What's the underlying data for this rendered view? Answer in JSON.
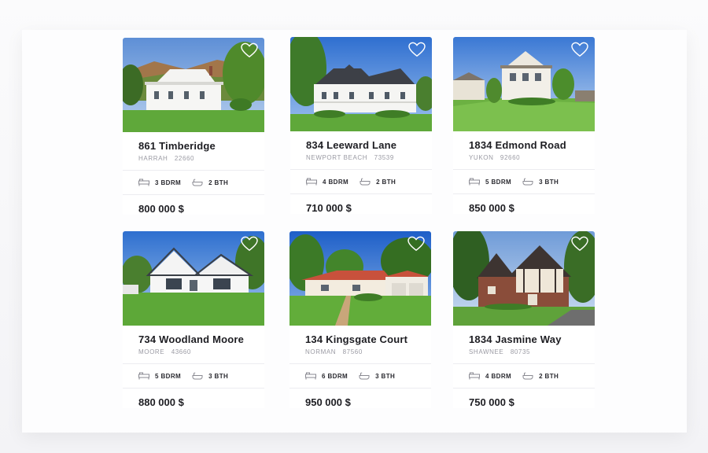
{
  "listings": [
    {
      "address": "861 Timberidge",
      "city": "HARRAH",
      "zip": "22660",
      "bedrooms": "3 BDRM",
      "bathrooms": "2 BTH",
      "price": "800 000 $",
      "photo": "white-farmhouse-with-porch"
    },
    {
      "address": "834 Leeward Lane",
      "city": "NEWPORT BEACH",
      "zip": "73539",
      "bedrooms": "4 BDRM",
      "bathrooms": "2 BTH",
      "price": "710 000 $",
      "photo": "white-two-story-colonial"
    },
    {
      "address": "1834 Edmond Road",
      "city": "YUKON",
      "zip": "92660",
      "bedrooms": "5 BDRM",
      "bathrooms": "3 BTH",
      "price": "850 000 $",
      "photo": "white-craftsman-house"
    },
    {
      "address": "734 Woodland Moore",
      "city": "MOORE",
      "zip": "43660",
      "bedrooms": "5 BDRM",
      "bathrooms": "3 BTH",
      "price": "880 000 $",
      "photo": "modern-white-gabled-house"
    },
    {
      "address": "134 Kingsgate Court",
      "city": "NORMAN",
      "zip": "87560",
      "bedrooms": "6 BDRM",
      "bathrooms": "3 BTH",
      "price": "950 000 $",
      "photo": "ranch-house-red-roof"
    },
    {
      "address": "1834 Jasmine Way",
      "city": "SHAWNEE",
      "zip": "80735",
      "bedrooms": "4 BDRM",
      "bathrooms": "2 BTH",
      "price": "750 000 $",
      "photo": "tudor-style-house"
    }
  ],
  "icons": {
    "favorite": "heart-outline-icon",
    "bedroom": "bed-icon",
    "bathroom": "bathtub-icon"
  },
  "colors": {
    "text": "#1d1d22",
    "muted": "#9a9aa3",
    "divider": "#ececf0",
    "background": "#f7f7f9"
  }
}
